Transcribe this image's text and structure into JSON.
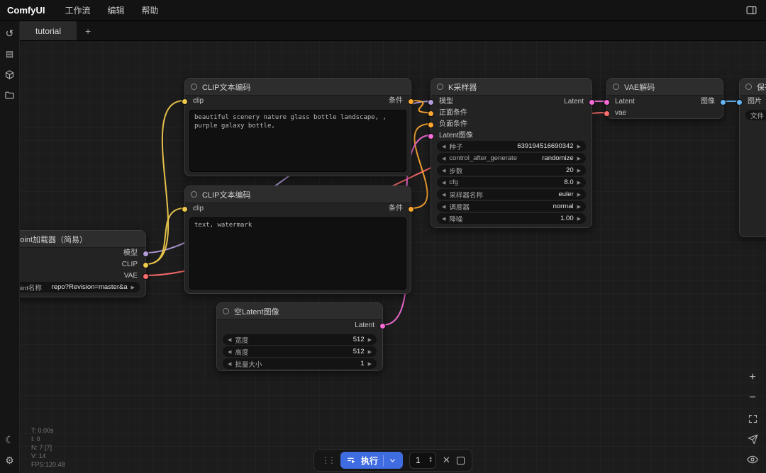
{
  "menubar": {
    "logo": "ComfyUI",
    "items": [
      "工作流",
      "编辑",
      "帮助"
    ]
  },
  "tabbar": {
    "active_tab": "tutorial",
    "add_button": "+"
  },
  "nodes": {
    "clip_pos": {
      "title": "CLIP文本编码",
      "input": "clip",
      "output": "条件",
      "text": "beautiful scenery nature glass bottle landscape, , purple galaxy bottle,"
    },
    "clip_neg": {
      "title": "CLIP文本编码",
      "input": "clip",
      "output": "条件",
      "text": "text, watermark"
    },
    "ksampler": {
      "title": "K采样器",
      "inputs": [
        "模型",
        "正面条件",
        "负面条件",
        "Latent图像"
      ],
      "output": "Latent",
      "widgets": [
        {
          "label": "种子",
          "value": "639194516690342"
        },
        {
          "label": "control_after_generate",
          "value": "randomize"
        },
        {
          "label": "步数",
          "value": "20"
        },
        {
          "label": "cfg",
          "value": "8.0"
        },
        {
          "label": "采样器名称",
          "value": "euler"
        },
        {
          "label": "调度器",
          "value": "normal"
        },
        {
          "label": "降噪",
          "value": "1.00"
        }
      ]
    },
    "vae_decode": {
      "title": "VAE解码",
      "inputs": [
        "Latent",
        "vae"
      ],
      "output": "图像"
    },
    "save_image": {
      "title": "保存图像",
      "input": "图片",
      "widget_label": "文件"
    },
    "checkpoint": {
      "title": "Checkpoint加载器（简易）",
      "outputs": [
        "模型",
        "CLIP",
        "VAE"
      ],
      "widget_label": "Checkpoint名称",
      "widget_value": "repo?Revision=master&a"
    },
    "empty_latent": {
      "title": "空Latent图像",
      "output": "Latent",
      "widgets": [
        {
          "label": "宽度",
          "value": "512"
        },
        {
          "label": "高度",
          "value": "512"
        },
        {
          "label": "批量大小",
          "value": "1"
        }
      ]
    }
  },
  "stats": {
    "lines": [
      "T: 0.00s",
      "I: 0",
      "N: 7 [7]",
      "V: 14",
      "FPS:120.48"
    ]
  },
  "queue_toolbar": {
    "run_label": "执行",
    "batch_count": "1"
  },
  "colors": {
    "accent_blue": "#3f6ce0",
    "model": "#B39DDB",
    "clip": "#EFC94C",
    "vae": "#FF6E6E",
    "conditioning": "#FFA931",
    "latent": "#F76BD6",
    "image": "#64B5F6"
  }
}
